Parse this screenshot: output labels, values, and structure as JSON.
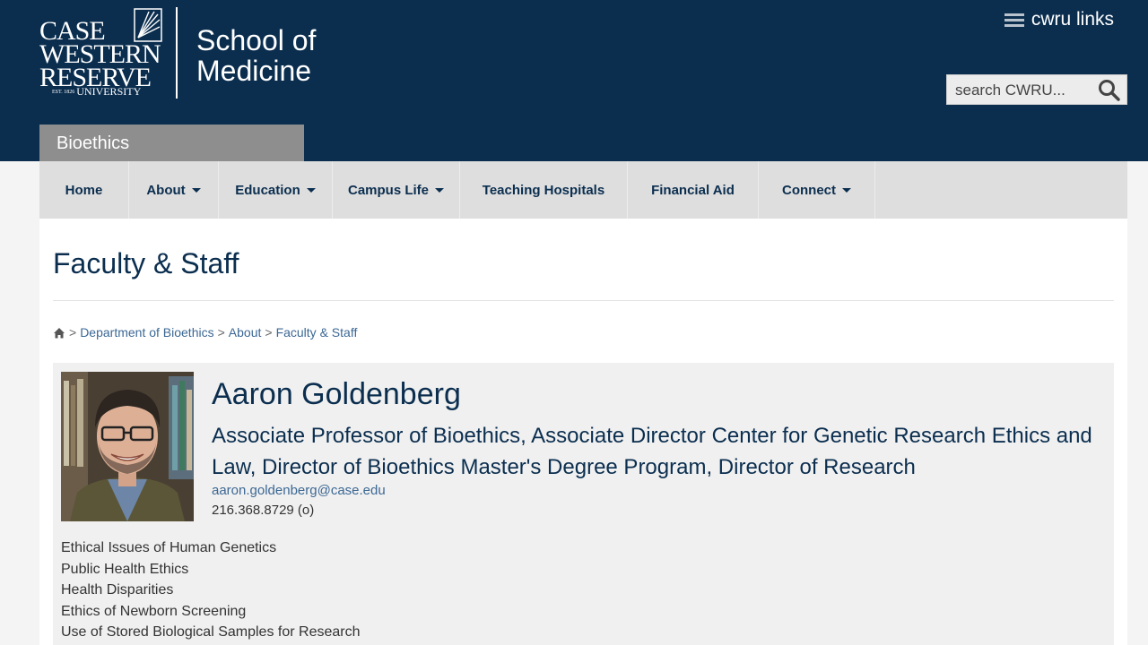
{
  "brand": {
    "logo_lines": [
      "CASE",
      "WESTERN",
      "RESERVE",
      "UNIVERSITY"
    ],
    "logo_est": "EST. 1826",
    "school_line1": "School of",
    "school_line2": "Medicine"
  },
  "header": {
    "links_label": "cwru links",
    "search_placeholder": "search CWRU..."
  },
  "department_tab": "Bioethics",
  "nav": [
    {
      "label": "Home",
      "has_dropdown": false
    },
    {
      "label": "About",
      "has_dropdown": true
    },
    {
      "label": "Education",
      "has_dropdown": true
    },
    {
      "label": "Campus Life",
      "has_dropdown": true
    },
    {
      "label": "Teaching Hospitals",
      "has_dropdown": false
    },
    {
      "label": "Financial Aid",
      "has_dropdown": false
    },
    {
      "label": "Connect",
      "has_dropdown": true
    }
  ],
  "page_title": "Faculty & Staff",
  "breadcrumb": {
    "separator": ">",
    "items": [
      "Department of Bioethics",
      "About",
      "Faculty & Staff"
    ]
  },
  "profile": {
    "name": "Aaron Goldenberg",
    "title": "Associate Professor of Bioethics, Associate Director Center for Genetic Research Ethics and Law, Director of Bioethics Master's Degree Program, Director of Research",
    "email": "aaron.goldenberg@case.edu",
    "phone": "216.368.8729 (o)",
    "interests": [
      "Ethical Issues of Human Genetics",
      "Public Health Ethics",
      "Health Disparities",
      "Ethics of Newborn Screening",
      "Use of Stored Biological Samples for Research"
    ]
  },
  "colors": {
    "header_bg": "#0b2e4f",
    "tab_bg": "#8e8e8e",
    "nav_bg": "#dedede",
    "profile_bg": "#f0f0f0",
    "link": "#3c6894"
  },
  "icons": [
    "hamburger-icon",
    "search-icon",
    "home-icon",
    "caret-down-icon"
  ]
}
